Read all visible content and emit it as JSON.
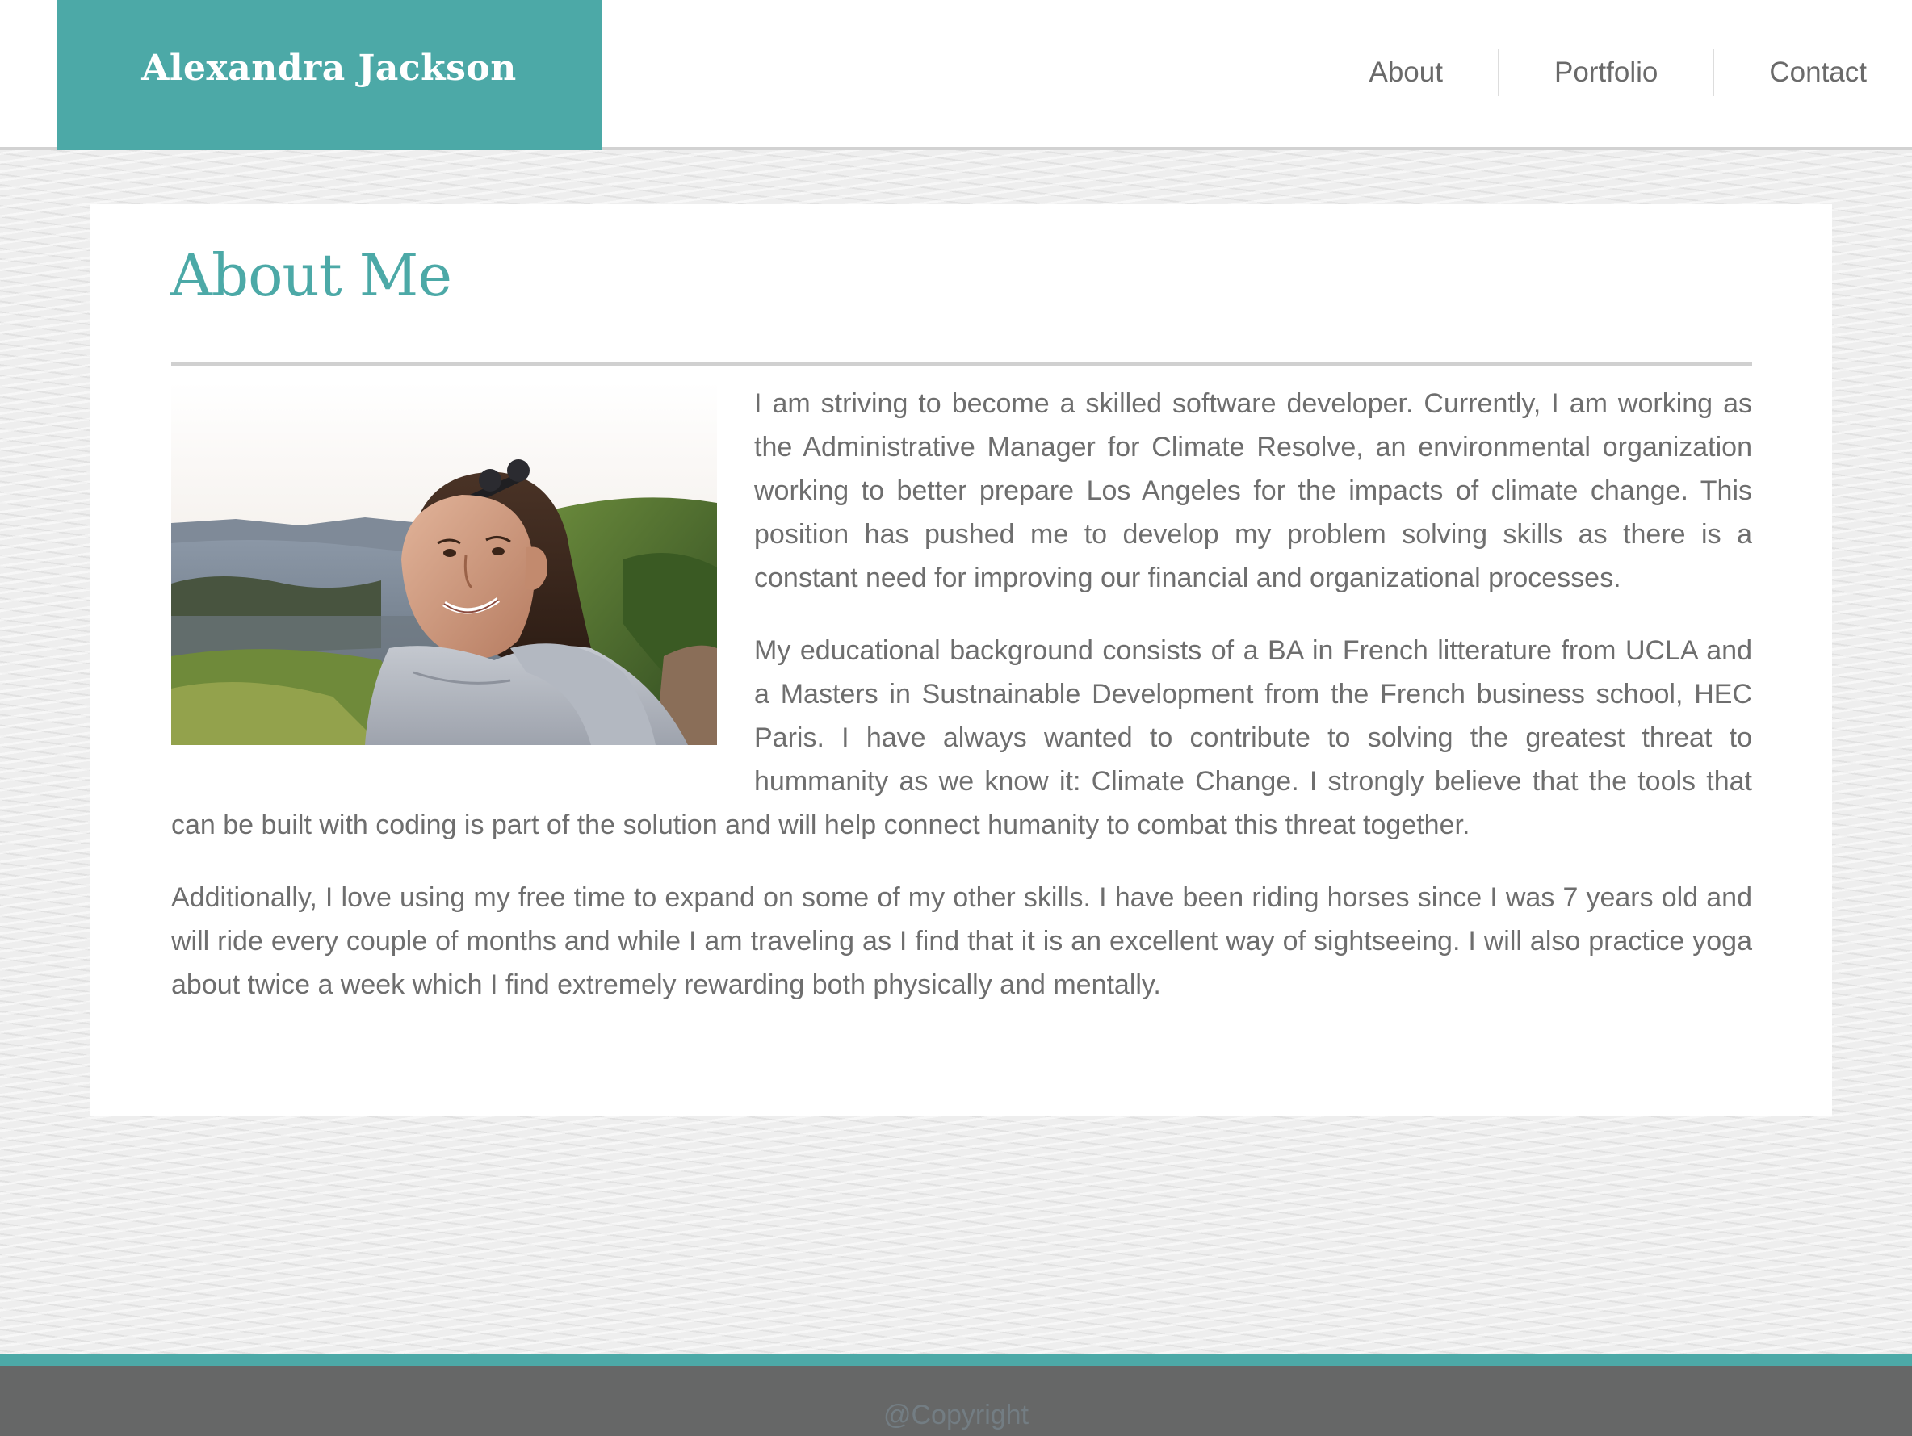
{
  "header": {
    "brand_title": "Alexandra Jackson",
    "nav": [
      {
        "label": "About"
      },
      {
        "label": "Portfolio"
      },
      {
        "label": "Contact"
      }
    ]
  },
  "main": {
    "page_title": "About Me",
    "paragraphs": [
      "I am striving to become a skilled software developer. Currently, I am working as the Administrative Manager for Climate Resolve, an environmental organization working to better prepare Los Angeles for the impacts of climate change. This position has pushed me to develop my problem solving skills as there is a constant need for improving our financial and organizational processes.",
      "My educational background consists of a BA in French litterature from UCLA and a Masters in Sustnainable Development from the French business school, HEC Paris. I have always wanted to contribute to solving the greatest threat to hummanity as we know it: Climate Change. I strongly believe that the tools that can be built with coding is part of the solution and will help connect humanity to combat this threat together.",
      "Additionally, I love using my free time to expand on some of my other skills. I have been riding horses since I was 7 years old and will ride every couple of months and while I am traveling as I find that it is an excellent way of sightseeing. I will also practice yoga about twice a week which I find extremely rewarding both physically and mentally."
    ]
  },
  "footer": {
    "copyright": "@Copyright"
  },
  "colors": {
    "accent": "#4ca9a7",
    "footer_bg": "#666767",
    "text": "#6e6e6e"
  }
}
